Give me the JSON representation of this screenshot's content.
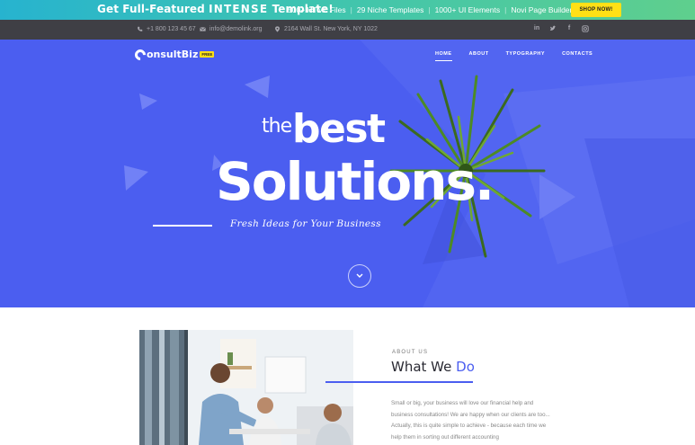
{
  "promo": {
    "title_pre": "Get Full-Featured",
    "title_brand": "INTENSE",
    "title_post": "Template!",
    "features": [
      "500+ HTML Files",
      "29 Niche Templates",
      "1000+ UI Elements",
      "Novi Page Builder"
    ],
    "button": "SHOP NOW!"
  },
  "contact": {
    "phone": "+1 800 123 45 67",
    "email": "info@demolink.org",
    "address": "2164 Wall St. New York, NY 1022",
    "social": [
      "linkedin-icon",
      "twitter-icon",
      "facebook-icon",
      "instagram-icon"
    ]
  },
  "header": {
    "logo_name": "onsultBiz",
    "logo_badge": "FREE",
    "nav": [
      "HOME",
      "ABOUT",
      "TYPOGRAPHY",
      "CONTACTS"
    ],
    "active_nav": "HOME"
  },
  "hero": {
    "the": "the",
    "best": "best",
    "solutions": "Solutions.",
    "subtitle": "Fresh Ideas for Your Business"
  },
  "about": {
    "kicker": "ABOUT US",
    "heading_pre": "What We",
    "heading_accent": "Do",
    "text": "Small or big, your business will love our financial help and business consultations! We are happy when our clients are too... Actually, this is quite simple to achieve - because each time we help them in sorting out different accounting"
  },
  "colors": {
    "accent": "#4b5ef0",
    "promo_button": "#ffe016",
    "contact_bar": "#3f3f45"
  }
}
